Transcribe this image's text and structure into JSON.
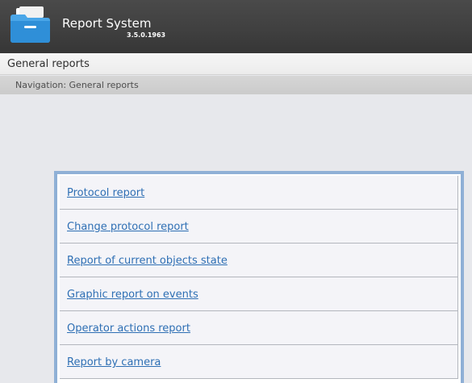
{
  "app": {
    "title": "Report System",
    "version": "3.5.0.1963",
    "logo_icon": "folder-icon"
  },
  "page": {
    "title": "General reports"
  },
  "navigation": {
    "text": "Navigation: General reports"
  },
  "reports": [
    {
      "label": "Protocol report"
    },
    {
      "label": "Change protocol report"
    },
    {
      "label": "Report of current objects state"
    },
    {
      "label": "Graphic report on events"
    },
    {
      "label": "Operator actions report"
    },
    {
      "label": "Report by camera"
    }
  ],
  "colors": {
    "header_bg": "#3f3f3f",
    "panel_border": "#8fb0d6",
    "link": "#2e6fb4",
    "background": "#e7e8ec"
  }
}
